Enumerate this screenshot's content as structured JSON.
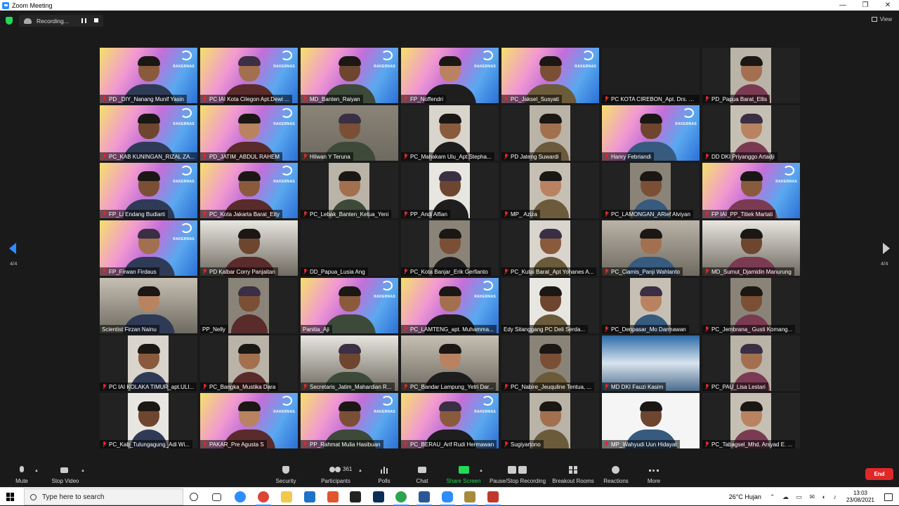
{
  "window": {
    "title": "Zoom Meeting",
    "controls": [
      "—",
      "❐",
      "✕"
    ]
  },
  "recording": {
    "label": "Recording..."
  },
  "view": {
    "label": "View"
  },
  "banner": {
    "text": "RAKERNAS"
  },
  "pagination": {
    "left": "4/4",
    "right": "4/4"
  },
  "participants": [
    {
      "name": "PD _DIY_Nanang Munif Yasin",
      "bg": "rak",
      "muted": true
    },
    {
      "name": "PC IAI Kota Cilegon Apt.Dewi ...",
      "bg": "rak",
      "muted": true
    },
    {
      "name": "MD_Banten_Raiyan",
      "bg": "rak",
      "muted": true
    },
    {
      "name": "FP_Noffendri",
      "bg": "rak",
      "muted": true
    },
    {
      "name": "PC_Jaksel_Susyati",
      "bg": "rak",
      "muted": true
    },
    {
      "name": "PC KOTA CIREBON_Apt. Drs. S...",
      "bg": "dark",
      "muted": true
    },
    {
      "name": "PD_Papua Barat_Ellis",
      "bg": "cam",
      "muted": true
    },
    {
      "name": "PC_KAB KUNINGAN_RIZAL ZA...",
      "bg": "rak",
      "muted": true
    },
    {
      "name": "PD_JATIM_ABDUL RAHEM",
      "bg": "rak",
      "muted": true
    },
    {
      "name": "Hilwan Y Teruna",
      "bg": "room",
      "muted": true
    },
    {
      "name": "PC_Mahakam Ulu_Apt.Stepha...",
      "bg": "cam",
      "muted": true
    },
    {
      "name": "PD Jateng Suwardi",
      "bg": "cam",
      "muted": true
    },
    {
      "name": "Hanry Febriandi",
      "bg": "rak",
      "muted": true
    },
    {
      "name": "DD DKI Priyanggo Artadji",
      "bg": "cam",
      "muted": true
    },
    {
      "name": "FP_Li Endang Budiarti",
      "bg": "rak",
      "muted": true
    },
    {
      "name": "PC_Kota Jakarta Barat_Etty",
      "bg": "rak",
      "muted": true
    },
    {
      "name": "PC_Lebak_Banten_Ketua_Yeni",
      "bg": "cam",
      "muted": true
    },
    {
      "name": "PP_Andi Alfian",
      "bg": "cam",
      "muted": true
    },
    {
      "name": "MP_ Aziza",
      "bg": "cam",
      "muted": true
    },
    {
      "name": "PC_LAMONGAN_ARief Alviyan",
      "bg": "cam",
      "muted": true
    },
    {
      "name": "FP IAI_PP_Titiek Martati",
      "bg": "rak",
      "muted": true
    },
    {
      "name": "FP_Firwan Firdaus",
      "bg": "rak",
      "muted": true
    },
    {
      "name": "PD Kalbar Corry Panjaitan",
      "bg": "room",
      "muted": true
    },
    {
      "name": "DD_Papua_Lusia Ang",
      "bg": "dark",
      "muted": true
    },
    {
      "name": "PC_Kota Banjar_Erik Gerfianto",
      "bg": "cam",
      "muted": true
    },
    {
      "name": "PC_Kutai Barat_Apt Yohanes A...",
      "bg": "cam",
      "muted": true
    },
    {
      "name": "PC_Ciamis_Panji Wahlanto",
      "bg": "room",
      "muted": true
    },
    {
      "name": "MD_Sumut_Djamidin Manurung",
      "bg": "room",
      "muted": true
    },
    {
      "name": "Scientist Firzan Nainu",
      "bg": "room",
      "muted": false
    },
    {
      "name": "PP_Nelly",
      "bg": "cam",
      "muted": false
    },
    {
      "name": "Panitia_Aji",
      "bg": "rak",
      "muted": false
    },
    {
      "name": "PC_LAMTENG_apt. Muhamma...",
      "bg": "rak",
      "muted": true
    },
    {
      "name": "Edy Sitanggang PC Deli Serda...",
      "bg": "cam",
      "muted": false
    },
    {
      "name": "PC_Denpasar_Mo Darmawan",
      "bg": "cam",
      "muted": true
    },
    {
      "name": "PC_Jembrana_ Gusti Komang...",
      "bg": "cam",
      "muted": true
    },
    {
      "name": "PC IAI KOLAKA TIMUR_apt.ULI...",
      "bg": "cam",
      "muted": true
    },
    {
      "name": "PC_Bangka_Mustika Dara",
      "bg": "cam",
      "muted": true
    },
    {
      "name": "Secretaris_Jatim_Mahardian R...",
      "bg": "room",
      "muted": true
    },
    {
      "name": "PC_Bandar Lampung_Yetri Dar...",
      "bg": "room",
      "muted": true
    },
    {
      "name": "PC_Nabire_Jeuquline Tentua, ...",
      "bg": "cam",
      "muted": true
    },
    {
      "name": "MD DKI Fauzi Kasim",
      "bg": "fuji",
      "muted": true
    },
    {
      "name": "PC_PAU_Lisa Lestari",
      "bg": "cam",
      "muted": true
    },
    {
      "name": "PC_Kab_Tulungagung_Adi Wi...",
      "bg": "cam",
      "muted": true
    },
    {
      "name": "PAKAR_Pre Agusta S",
      "bg": "rak",
      "muted": true
    },
    {
      "name": "PP_Rahmat Mulia Hasibuan",
      "bg": "rak",
      "muted": true
    },
    {
      "name": "PC_BERAU_Arif Rudi Hermawan",
      "bg": "rak",
      "muted": true
    },
    {
      "name": "Sugiyartono",
      "bg": "cam",
      "muted": true
    },
    {
      "name": "MP_Wahyudi Uun Hidayat",
      "bg": "slide",
      "muted": true
    },
    {
      "name": "PC_Tabagsel_Mhd. Arsyad E. ...",
      "bg": "cam",
      "muted": true
    }
  ],
  "toolbar": {
    "mute": "Mute",
    "stop_video": "Stop Video",
    "security": "Security",
    "participants": "Participants",
    "participant_count": "361",
    "polls": "Polls",
    "chat": "Chat",
    "share_screen": "Share Screen",
    "recording": "Pause/Stop Recording",
    "breakout": "Breakout Rooms",
    "reactions": "Reactions",
    "more": "More",
    "end": "End"
  },
  "taskbar": {
    "search_placeholder": "Type here to search",
    "weather": "26°C  Hujan",
    "time": "13:03",
    "date": "23/08/2021"
  }
}
